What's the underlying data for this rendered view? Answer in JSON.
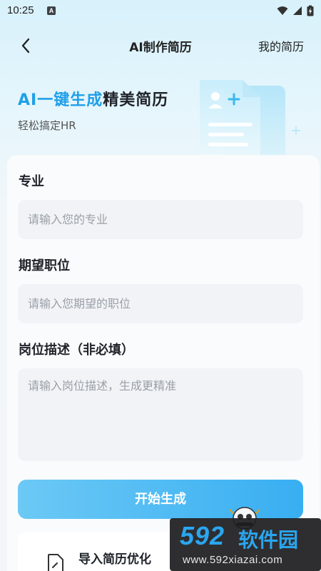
{
  "status_bar": {
    "time": "10:25",
    "badge": "A",
    "icons": [
      "wifi-icon",
      "signal-icon",
      "battery-charging-icon"
    ]
  },
  "nav": {
    "back_icon": "chevron-left-icon",
    "title": "AI制作简历",
    "right_link": "我的简历"
  },
  "hero": {
    "title_accent": "AI一键生成",
    "title_rest": "精美简历",
    "subtitle": "轻松搞定HR"
  },
  "form": {
    "major": {
      "label": "专业",
      "placeholder": "请输入您的专业",
      "value": ""
    },
    "position": {
      "label": "期望职位",
      "placeholder": "请输入您期望的职位",
      "value": ""
    },
    "description": {
      "label": "岗位描述（非必填）",
      "placeholder": "请输入岗位描述，生成更精准",
      "value": ""
    },
    "submit_label": "开始生成"
  },
  "import": {
    "icon": "document-edit-icon",
    "label": "导入简历优化"
  },
  "watermark": {
    "number": "592",
    "text": "软件园",
    "url": "www.592xiazai.com"
  },
  "colors": {
    "accent": "#1fa0e8",
    "button_start": "#6cc9f5",
    "button_end": "#38aef2",
    "field_bg": "#f1f3f6"
  }
}
